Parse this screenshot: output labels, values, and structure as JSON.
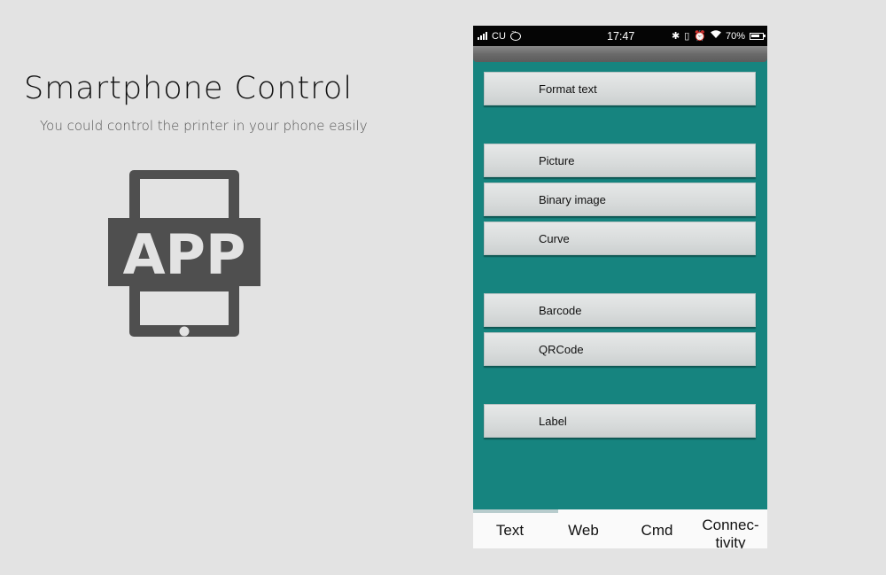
{
  "promo": {
    "title": "Smartphone Control",
    "subtitle": "You could control the printer in your phone easily",
    "icon_label": "APP",
    "icon_color": "#4f4f4f"
  },
  "phone": {
    "statusbar": {
      "carrier": "CU",
      "time": "17:47",
      "battery_percent": "70%",
      "icons_left": [
        "signal-icon",
        "chat-bubble-icon"
      ],
      "icons_right": [
        "bluetooth-icon",
        "vibrate-icon",
        "alarm-icon",
        "wifi-icon",
        "battery-icon"
      ]
    },
    "accent_color": "#16847f",
    "menu": [
      {
        "label": "Format text"
      },
      {
        "label": "Picture"
      },
      {
        "label": "Binary image"
      },
      {
        "label": "Curve"
      },
      {
        "label": "Barcode"
      },
      {
        "label": "QRCode"
      },
      {
        "label": "Label"
      }
    ],
    "tabs": [
      {
        "label": "Text",
        "active": true
      },
      {
        "label": "Web",
        "active": false
      },
      {
        "label": "Cmd",
        "active": false
      },
      {
        "label": "Connec-\ntivity",
        "active": false
      }
    ]
  }
}
